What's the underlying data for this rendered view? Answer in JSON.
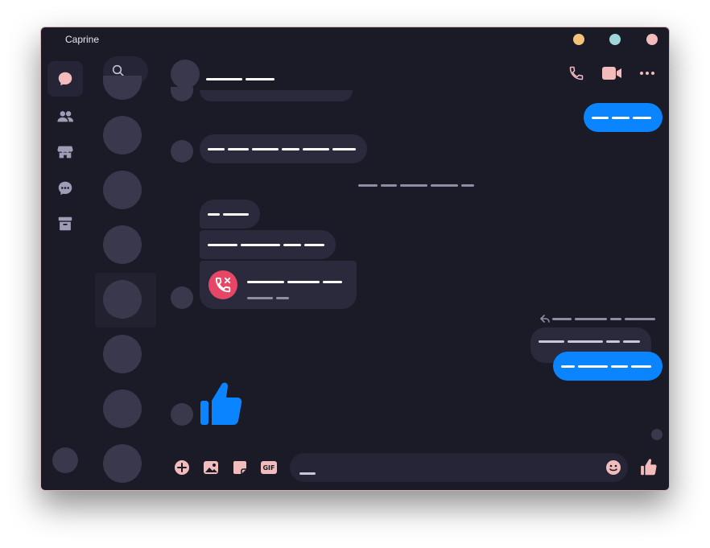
{
  "app": {
    "title": "Caprine"
  },
  "window_controls": [
    {
      "name": "minimize",
      "color": "#f4c27a"
    },
    {
      "name": "maximize",
      "color": "#9fd6dc"
    },
    {
      "name": "close",
      "color": "#f2bcbc"
    }
  ],
  "sidebar": {
    "items": [
      {
        "name": "chats",
        "icon": "chat-bubble-icon",
        "active": true
      },
      {
        "name": "people",
        "icon": "people-icon",
        "active": false
      },
      {
        "name": "marketplace",
        "icon": "store-icon",
        "active": false
      },
      {
        "name": "message-requests",
        "icon": "message-request-icon",
        "active": false
      },
      {
        "name": "archived",
        "icon": "archive-icon",
        "active": false
      }
    ]
  },
  "colors": {
    "background": "#1b1a27",
    "incoming_bubble": "#2b2a3d",
    "outgoing_bubble": "#0a84ff",
    "accent_icons": "#f2bcbc",
    "missed_call": "#e64766"
  },
  "chat": {
    "header_icons": [
      "phone-icon",
      "video-camera-icon",
      "more-options-icon"
    ]
  },
  "composer": {
    "icons": [
      "add-icon",
      "image-icon",
      "sticker-icon",
      "gif-icon",
      "emoji-icon",
      "like-icon"
    ],
    "gif_label": "GIF"
  }
}
